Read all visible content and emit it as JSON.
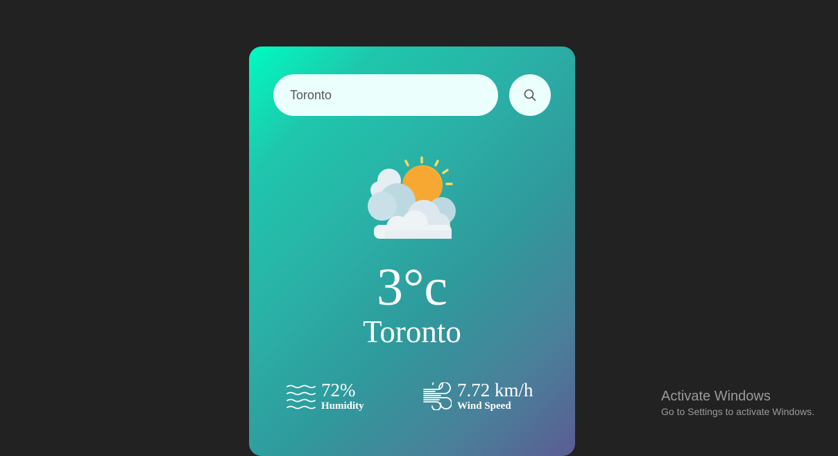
{
  "search": {
    "value": "Toronto",
    "icon": "search-icon"
  },
  "weather": {
    "icon": "partly-cloudy-icon",
    "temperature": "3°c",
    "city": "Toronto"
  },
  "details": {
    "humidity": {
      "icon": "humidity-icon",
      "value": "72%",
      "label": "Humidity"
    },
    "wind": {
      "icon": "wind-icon",
      "value": "7.72 km/h",
      "label": "Wind Speed"
    }
  },
  "windows_notice": {
    "title": "Activate Windows",
    "subtitle": "Go to Settings to activate Windows."
  },
  "colors": {
    "page_background": "#222222",
    "card_gradient_start": "#00fbc0",
    "card_gradient_end": "#5b5c93",
    "input_background": "#ebfffc",
    "text": "#ffffff"
  }
}
